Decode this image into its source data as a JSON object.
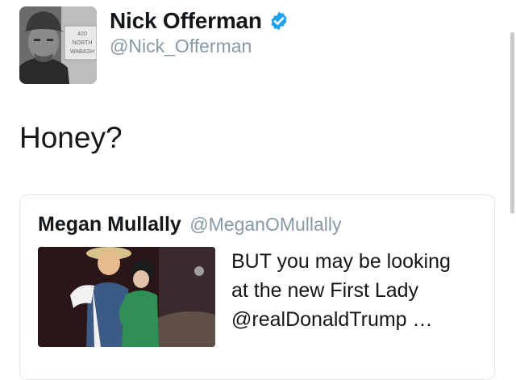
{
  "author": {
    "display_name": "Nick Offerman",
    "handle": "@Nick_Offerman",
    "verified_icon": "verified-badge-icon",
    "avatar_sign_lines": [
      "420",
      "NORTH",
      "WABASH"
    ]
  },
  "tweet": {
    "text": "Honey?"
  },
  "quoted_tweet": {
    "display_name": "Megan Mullally",
    "handle": "@MeganOMullally",
    "text_lines": [
      "BUT you may be looking",
      "at the new First Lady",
      "@realDonaldTrump …"
    ]
  },
  "colors": {
    "text_primary": "#14171a",
    "text_secondary": "#8899a6",
    "verified_blue": "#1da1f2",
    "card_border": "#e1e8ed"
  }
}
